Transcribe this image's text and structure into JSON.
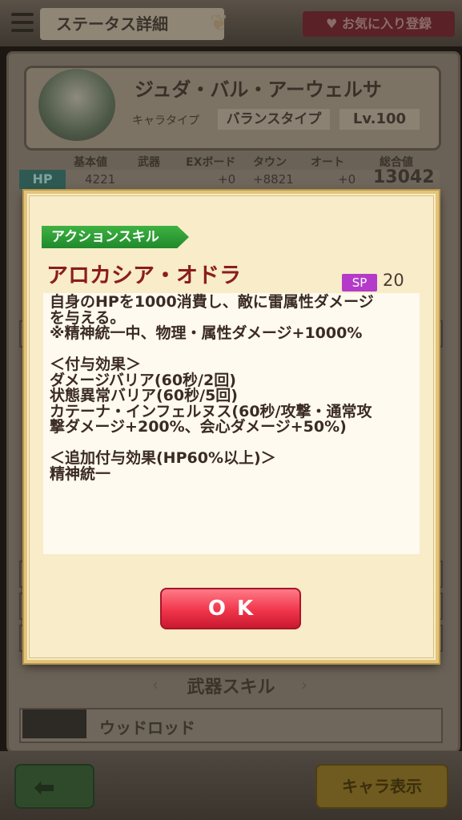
{
  "header": {
    "title": "ステータス詳細",
    "favorite_label": "お気に入り登録"
  },
  "character": {
    "name": "ジュダ・バル・アーウェルサ",
    "type_label": "キャラタイプ",
    "type_value": "バランスタイプ",
    "level": "Lv.100"
  },
  "stats": {
    "headers": [
      "基本値",
      "武器",
      "EXボード",
      "タウン",
      "オート",
      "総合値"
    ],
    "hp": {
      "label": "HP",
      "base": "4221",
      "ex_board": "+0",
      "town": "+8821",
      "auto": "+0",
      "total": "13042"
    }
  },
  "weapon_section": {
    "title": "武器スキル",
    "item_name": "ウッドロッド"
  },
  "bottom": {
    "chara_button": "キャラ表示"
  },
  "dialog": {
    "tag": "アクションスキル",
    "skill_name": "アロカシア・オドラ",
    "sp_label": "SP",
    "sp_value": "20",
    "description": "自身のHPを1000消費し、敵に雷属性ダメージ\nを与える。\n※精神統一中、物理・属性ダメージ+1000%\n\n＜付与効果＞\nダメージバリア(60秒/2回)\n状態異常バリア(60秒/5回)\nカテーナ・インフェルヌス(60秒/攻撃・通常攻\n撃ダメージ+200%、会心ダメージ+50%)\n\n＜追加付与効果(HP60%以上)＞\n精神統一",
    "ok_label": "OK"
  }
}
